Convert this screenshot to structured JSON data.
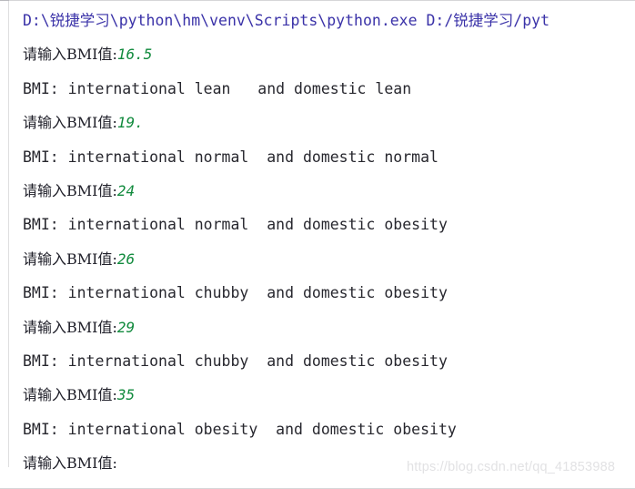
{
  "console": {
    "name": "python-run-console",
    "background_color": "#ffffff",
    "command_color": "#3a32a8",
    "prompt_color": "#20202a",
    "input_value_color": "#118a3d",
    "output_color": "#27272e",
    "watermark_color": "#e2e2e4",
    "command_line": "D:\\锐捷学习\\python\\hm\\venv\\Scripts\\python.exe D:/锐捷学习/pyt",
    "prompt_label": "请输入BMI值:",
    "entries": [
      {
        "input": "16.5",
        "output": "BMI: international lean   and domestic lean"
      },
      {
        "input": "19.",
        "output": "BMI: international normal  and domestic normal"
      },
      {
        "input": "24",
        "output": "BMI: international normal  and domestic obesity"
      },
      {
        "input": "26",
        "output": "BMI: international chubby  and domestic obesity"
      },
      {
        "input": "29",
        "output": "BMI: international chubby  and domestic obesity"
      },
      {
        "input": "35",
        "output": "BMI: international obesity  and domestic obesity"
      }
    ],
    "final_prompt": "请输入BMI值:",
    "watermark": "https://blog.csdn.net/qq_41853988"
  }
}
